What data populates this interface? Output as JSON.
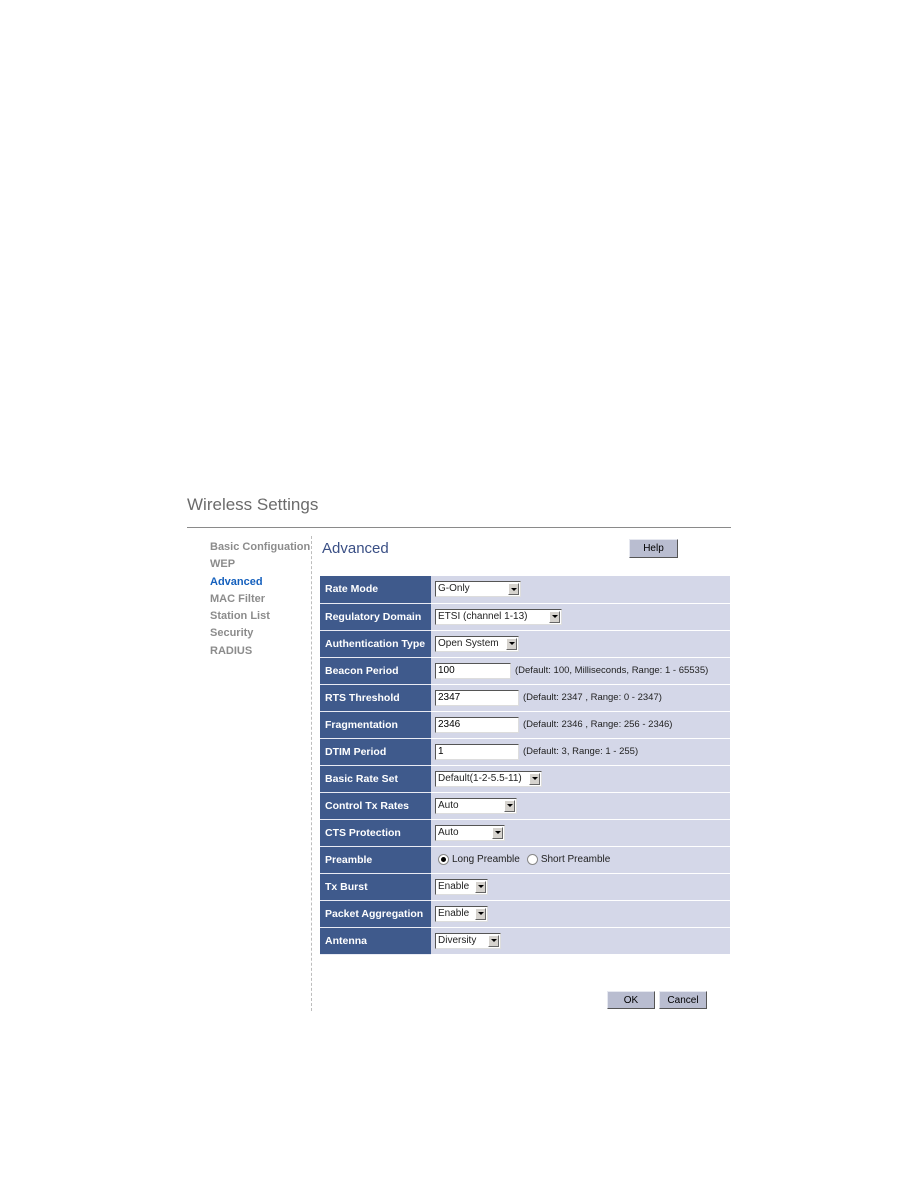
{
  "page": {
    "title": "Wireless Settings"
  },
  "sidebar": {
    "items": [
      {
        "label": "Basic Configuation",
        "active": false
      },
      {
        "label": "WEP",
        "active": false
      },
      {
        "label": "Advanced",
        "active": true
      },
      {
        "label": "MAC Filter",
        "active": false
      },
      {
        "label": "Station List",
        "active": false
      },
      {
        "label": "Security",
        "active": false
      },
      {
        "label": "RADIUS",
        "active": false
      }
    ]
  },
  "section": {
    "title": "Advanced",
    "help_label": "Help"
  },
  "form": {
    "rate_mode": {
      "label": "Rate Mode",
      "value": "G-Only"
    },
    "regulatory_domain": {
      "label": "Regulatory Domain",
      "value": "ETSI (channel 1-13)"
    },
    "authentication_type": {
      "label": "Authentication Type",
      "value": "Open System"
    },
    "beacon_period": {
      "label": "Beacon Period",
      "value": "100",
      "hint": "(Default: 100, Milliseconds, Range: 1 - 65535)"
    },
    "rts_threshold": {
      "label": "RTS Threshold",
      "value": "2347",
      "hint": "(Default: 2347 , Range: 0 - 2347)"
    },
    "fragmentation": {
      "label": "Fragmentation",
      "value": "2346",
      "hint": "(Default: 2346 , Range: 256 - 2346)"
    },
    "dtim_period": {
      "label": "DTIM Period",
      "value": "1",
      "hint": "(Default: 3, Range: 1 - 255)"
    },
    "basic_rate_set": {
      "label": "Basic Rate Set",
      "value": "Default(1-2-5.5-11)"
    },
    "control_tx_rates": {
      "label": "Control Tx Rates",
      "value": "Auto"
    },
    "cts_protection": {
      "label": "CTS Protection",
      "value": "Auto"
    },
    "preamble": {
      "label": "Preamble",
      "options": [
        "Long Preamble",
        "Short Preamble"
      ],
      "selected": "Long Preamble"
    },
    "tx_burst": {
      "label": "Tx Burst",
      "value": "Enable"
    },
    "packet_aggregation": {
      "label": "Packet Aggregation",
      "value": "Enable"
    },
    "antenna": {
      "label": "Antenna",
      "value": "Diversity"
    }
  },
  "footer": {
    "ok_label": "OK",
    "cancel_label": "Cancel"
  },
  "colors": {
    "label_bg": "#3f5a8c",
    "value_bg": "#d4d7e8",
    "active_link": "#1560bd",
    "inactive_link": "#8c8c8c"
  }
}
